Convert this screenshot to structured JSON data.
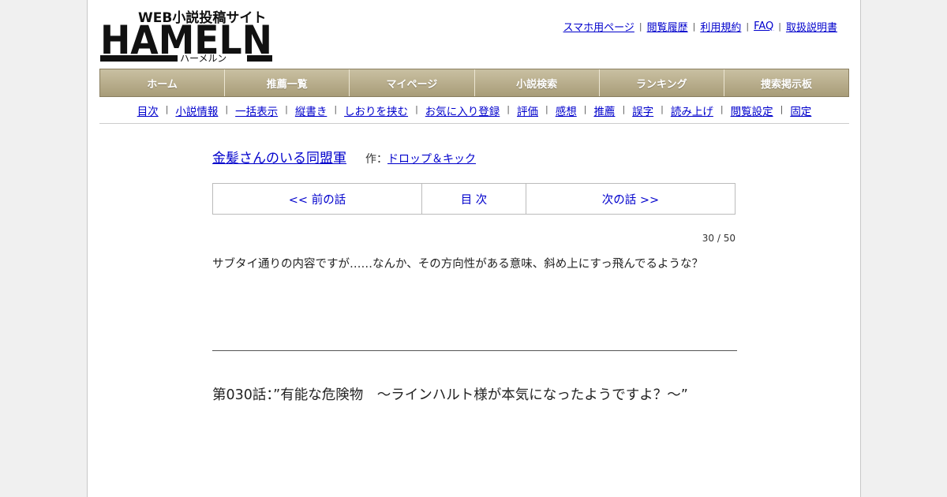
{
  "site": {
    "tagline": "WEB小説投稿サイト",
    "logo_text": "HAMELN",
    "logo_kana": "ハーメルン"
  },
  "header_links": [
    "スマホ用ページ",
    "閲覧履歴",
    "利用規約",
    "FAQ",
    "取扱説明書"
  ],
  "main_nav": [
    "ホーム",
    "推薦一覧",
    "マイページ",
    "小説検索",
    "ランキング",
    "捜索掲示板"
  ],
  "sub_nav": [
    "目次",
    "小説情報",
    "一括表示",
    "縦書き",
    "しおりを挟む",
    "お気に入り登録",
    "評価",
    "感想",
    "推薦",
    "誤字",
    "読み上げ",
    "閲覧設定",
    "固定"
  ],
  "novel": {
    "title": "金髪さんのいる同盟軍",
    "author_label": "作：",
    "author": "ドロップ＆キック"
  },
  "episode_nav": {
    "prev": "<< 前の話",
    "toc": "目 次",
    "next": "次の話 >>"
  },
  "counter": "30 / 50",
  "preface": "サブタイ通りの内容ですが……なんか、その方向性がある意味、斜め上にすっ飛んでるような？",
  "chapter_title": "第030話：”有能な危険物　～ラインハルト様が本気になったようですよ？～”",
  "colors": {
    "nav_bg": "#b5aa87",
    "link": "#0000cc"
  }
}
